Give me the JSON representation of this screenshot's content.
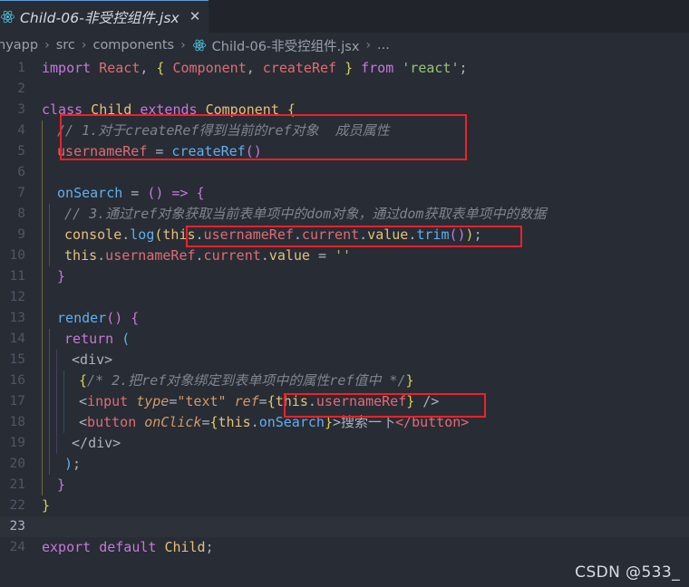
{
  "tab": {
    "label": "Child-06-非受控组件.jsx",
    "close_label": "✕",
    "icon": "react-icon"
  },
  "breadcrumb": {
    "items": [
      "nyapp",
      "src",
      "components",
      "Child-06-非受控组件.jsx",
      "..."
    ],
    "separator": "›",
    "file_icon": "react-icon"
  },
  "watermark": "CSDN @533_",
  "editor": {
    "active_line": 23,
    "line_numbers": [
      "1",
      "2",
      "3",
      "4",
      "5",
      "6",
      "7",
      "8",
      "9",
      "10",
      "11",
      "12",
      "13",
      "14",
      "15",
      "16",
      "17",
      "18",
      "19",
      "20",
      "21",
      "22",
      "23",
      "24"
    ],
    "lines_plain": [
      "import React, { Component, createRef } from 'react';",
      "",
      "class Child extends Component {",
      "  // 1.对于createRef得到当前的ref对象  成员属性",
      "  usernameRef = createRef()",
      "",
      "  onSearch = () => {",
      "    // 3.通过ref对象获取当前表单项中的dom对象，通过dom获取表单项中的数据",
      "    console.log(this.usernameRef.current.value.trim());",
      "    this.usernameRef.current.value = ''",
      "  }",
      "",
      "  render() {",
      "    return (",
      "      <div>",
      "        {/* 2.把ref对象绑定到表单项中的属性ref值中 */}",
      "        <input type=\"text\" ref={this.usernameRef} />",
      "        <button onClick={this.onSearch}>搜索一下</button>",
      "      </div>",
      "    );",
      "  }",
      "}",
      "",
      "export default Child;"
    ],
    "tokens": {
      "l1_import": "import",
      "l1_react": "React",
      "l1_comma": ",",
      "l1_obrace": "{",
      "l1_component": "Component",
      "l1_createref": "createRef",
      "l1_cbrace": "}",
      "l1_from": "from",
      "l1_str": "'react'",
      "l1_semi": ";",
      "l3_class": "class",
      "l3_child": "Child",
      "l3_extends": "extends",
      "l3_component": "Component",
      "l3_obrace": "{",
      "l4_comment": "// 1.对于createRef得到当前的ref对象  成员属性",
      "l5_ref": "usernameRef",
      "l5_eq": "=",
      "l5_createref": "createRef",
      "l5_parens": "()",
      "l7_onsearch": "onSearch",
      "l7_eq": "=",
      "l7_parens": "()",
      "l7_arrow": "=>",
      "l7_obrace": "{",
      "l8_comment": "// 3.通过ref对象获取当前表单项中的dom对象，通过dom获取表单项中的数据",
      "l9_console": "console",
      "l9_dot1": ".",
      "l9_log": "log",
      "l9_oparen": "(",
      "l9_this": "this",
      "l9_ref": "usernameRef",
      "l9_current": "current",
      "l9_value": "value",
      "l9_trim": "trim",
      "l9_trimparens": "()",
      "l9_cparen": ")",
      "l9_semi": ";",
      "l10_this": "this",
      "l10_ref": "usernameRef",
      "l10_current": "current",
      "l10_value": "value",
      "l10_eq": "=",
      "l10_empty": "''",
      "l11_cbrace": "}",
      "l13_render": "render",
      "l13_parens": "()",
      "l13_obrace": "{",
      "l14_return": "return",
      "l14_oparen": "(",
      "l15_div": "<div>",
      "l16_obrace": "{",
      "l16_comment": "/* 2.把ref对象绑定到表单项中的属性ref值中 */",
      "l16_cbrace": "}",
      "l17_lt": "<",
      "l17_input": "input",
      "l17_type": "type",
      "l17_eq": "=",
      "l17_text": "\"text\"",
      "l17_ref": "ref",
      "l17_obrace": "{",
      "l17_this": "this",
      "l17_dot": ".",
      "l17_usernameref": "usernameRef",
      "l17_cbrace": "}",
      "l17_close": "/>",
      "l18_lt": "<",
      "l18_button": "button",
      "l18_onclick": "onClick",
      "l18_eq": "=",
      "l18_obrace": "{",
      "l18_this": "this",
      "l18_dot": ".",
      "l18_onsearch": "onSearch",
      "l18_cbrace": "}",
      "l18_gt": ">",
      "l18_label": "搜索一下",
      "l18_endtag": "</button>",
      "l19_divclose": "</div>",
      "l20_cparen": ")",
      "l20_semi": ";",
      "l21_cbrace": "}",
      "l22_cbrace": "}",
      "l24_export": "export",
      "l24_default": "default",
      "l24_child": "Child",
      "l24_semi": ";"
    }
  },
  "colors": {
    "editor_bg": "#282c34",
    "tabbar_bg": "#21252b",
    "active_tab_border": "#5e9cd6",
    "annotation_red": "#f0202a",
    "keyword_purple": "#c678dd",
    "class_yellow": "#e5c07b",
    "variable_salmon": "#e06c75",
    "function_blue": "#61afef",
    "string_green": "#98c379",
    "comment_gray": "#7f848e"
  }
}
